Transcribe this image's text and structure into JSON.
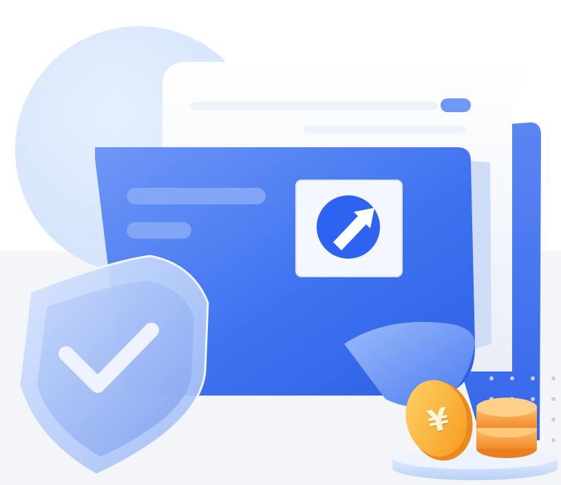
{
  "illustration": {
    "colors": {
      "primary_blue": "#3f73f0",
      "light_blue": "#dbe8fc",
      "ground": "#f4f5f8",
      "coin_gold": "#f5a623"
    },
    "icons": [
      "shield-check-icon",
      "upload-arrow-icon",
      "yuan-coin-icon",
      "document-icon",
      "folder-icon"
    ],
    "coin_symbol": "¥"
  }
}
